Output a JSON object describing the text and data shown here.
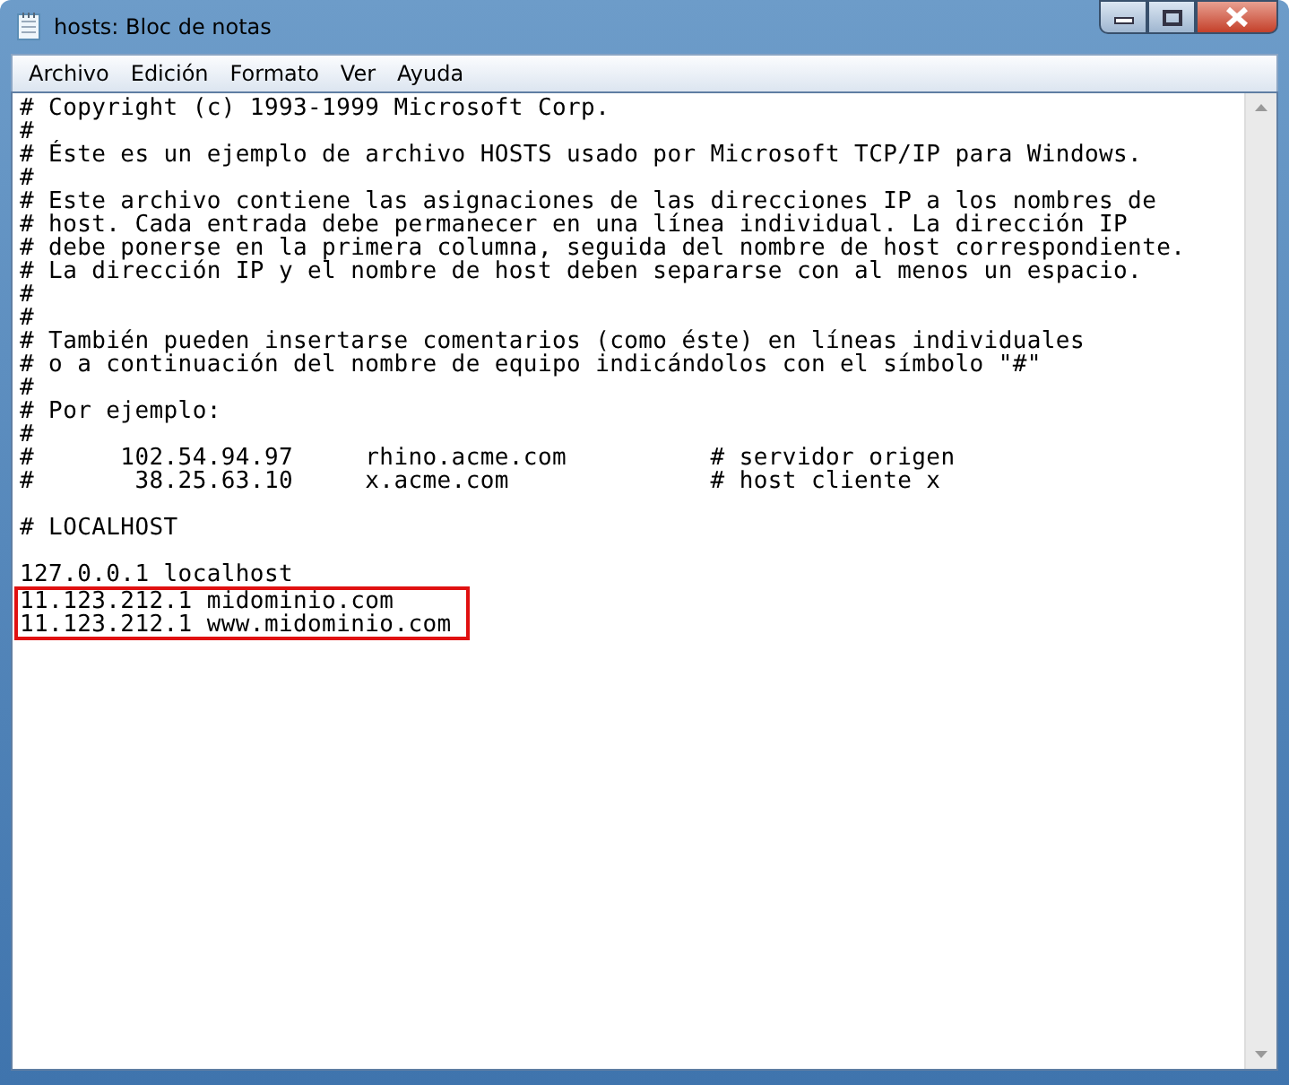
{
  "window": {
    "title": "hosts: Bloc de notas"
  },
  "menu": [
    "Archivo",
    "Edición",
    "Formato",
    "Ver",
    "Ayuda"
  ],
  "editor": {
    "blocks": [
      {
        "lines": [
          "# Copyright (c) 1993-1999 Microsoft Corp.",
          "#",
          "# Éste es un ejemplo de archivo HOSTS usado por Microsoft TCP/IP para Windows.",
          "#",
          "# Este archivo contiene las asignaciones de las direcciones IP a los nombres de",
          "# host. Cada entrada debe permanecer en una línea individual. La dirección IP",
          "# debe ponerse en la primera columna, seguida del nombre de host correspondiente.",
          "# La dirección IP y el nombre de host deben separarse con al menos un espacio.",
          "#",
          "#",
          "# También pueden insertarse comentarios (como éste) en líneas individuales",
          "# o a continuación del nombre de equipo indicándolos con el símbolo \"#\"",
          "#",
          "# Por ejemplo:",
          "#",
          "#      102.54.94.97     rhino.acme.com          # servidor origen",
          "#       38.25.63.10     x.acme.com              # host cliente x"
        ]
      },
      {
        "lines": [
          "# LOCALHOST"
        ]
      },
      {
        "lines": [
          "127.0.0.1 localhost"
        ],
        "marked_lines": [
          "11.123.212.1 midominio.com",
          "11.123.212.1 www.midominio.com"
        ]
      }
    ]
  }
}
